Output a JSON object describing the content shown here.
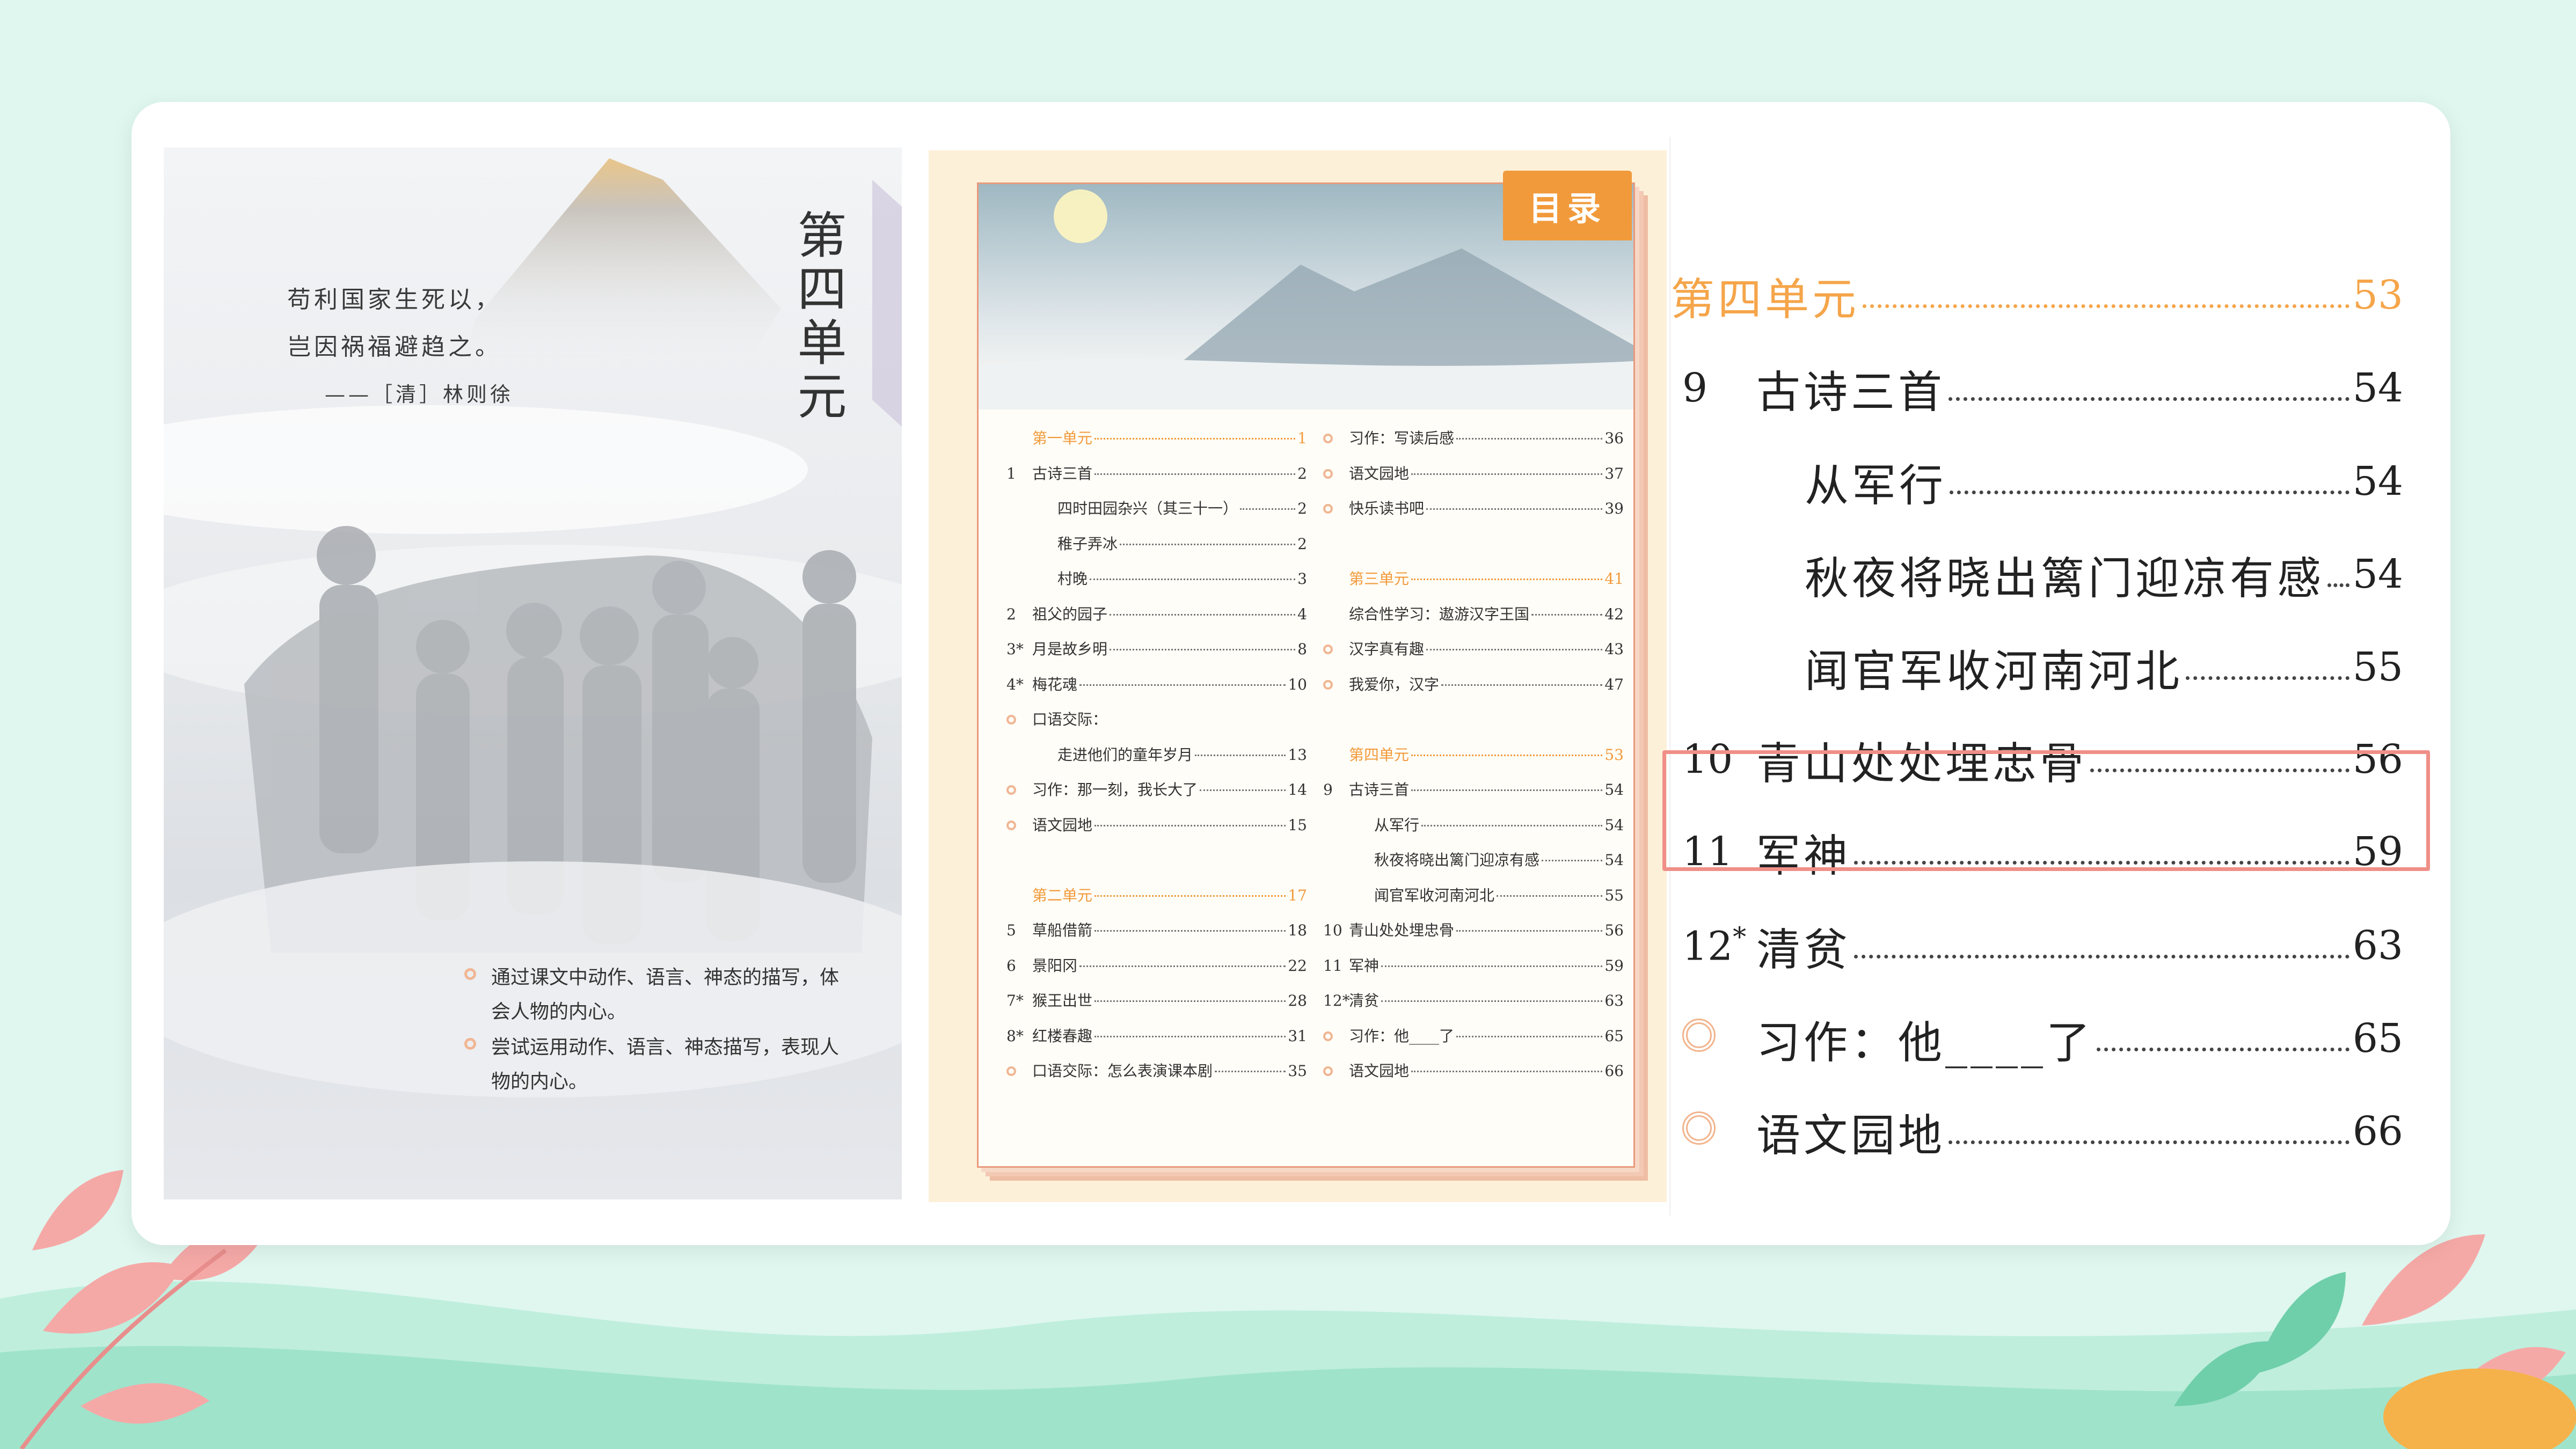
{
  "cover": {
    "title": "第四单元",
    "poem_line1": "苟利国家生死以，",
    "poem_line2": "岂因祸福避趋之。",
    "poem_author": "——［清］林则徐",
    "goal1": "通过课文中动作、语言、神态的描写，体会人物的内心。",
    "goal2": "尝试运用动作、语言、神态描写，表现人物的内心。"
  },
  "toc": {
    "banner": "目录",
    "left": [
      {
        "type": "unit",
        "num": "",
        "label": "第一单元",
        "page": "1"
      },
      {
        "type": "item",
        "num": "1",
        "label": "古诗三首",
        "page": "2"
      },
      {
        "type": "sub",
        "num": "",
        "label": "四时田园杂兴（其三十一）",
        "page": "2"
      },
      {
        "type": "sub",
        "num": "",
        "label": "稚子弄冰",
        "page": "2"
      },
      {
        "type": "sub",
        "num": "",
        "label": "村晚",
        "page": "3"
      },
      {
        "type": "item",
        "num": "2",
        "label": "祖父的园子",
        "page": "4"
      },
      {
        "type": "item",
        "num": "3*",
        "label": "月是故乡明",
        "page": "8"
      },
      {
        "type": "item",
        "num": "4*",
        "label": "梅花魂",
        "page": "10"
      },
      {
        "type": "circle",
        "num": "",
        "label": "口语交际：",
        "page": ""
      },
      {
        "type": "sub",
        "num": "",
        "label": "走进他们的童年岁月",
        "page": "13"
      },
      {
        "type": "circle",
        "num": "",
        "label": "习作：那一刻，我长大了",
        "page": "14"
      },
      {
        "type": "circle",
        "num": "",
        "label": "语文园地",
        "page": "15"
      },
      {
        "type": "gap",
        "num": "",
        "label": "",
        "page": ""
      },
      {
        "type": "unit",
        "num": "",
        "label": "第二单元",
        "page": "17"
      },
      {
        "type": "item",
        "num": "5",
        "label": "草船借箭",
        "page": "18"
      },
      {
        "type": "item",
        "num": "6",
        "label": "景阳冈",
        "page": "22"
      },
      {
        "type": "item",
        "num": "7*",
        "label": "猴王出世",
        "page": "28"
      },
      {
        "type": "item",
        "num": "8*",
        "label": "红楼春趣",
        "page": "31"
      },
      {
        "type": "circle",
        "num": "",
        "label": "口语交际：怎么表演课本剧",
        "page": "35"
      }
    ],
    "right": [
      {
        "type": "circle",
        "num": "",
        "label": "习作：写读后感",
        "page": "36"
      },
      {
        "type": "circle",
        "num": "",
        "label": "语文园地",
        "page": "37"
      },
      {
        "type": "circle",
        "num": "",
        "label": "快乐读书吧",
        "page": "39"
      },
      {
        "type": "gap",
        "num": "",
        "label": "",
        "page": ""
      },
      {
        "type": "unit",
        "num": "",
        "label": "第三单元",
        "page": "41"
      },
      {
        "type": "item",
        "num": "",
        "label": "综合性学习：遨游汉字王国",
        "page": "42"
      },
      {
        "type": "circle",
        "num": "",
        "label": "汉字真有趣",
        "page": "43"
      },
      {
        "type": "circle",
        "num": "",
        "label": "我爱你，汉字",
        "page": "47"
      },
      {
        "type": "gap",
        "num": "",
        "label": "",
        "page": ""
      },
      {
        "type": "unit",
        "num": "",
        "label": "第四单元",
        "page": "53"
      },
      {
        "type": "item",
        "num": "9",
        "label": "古诗三首",
        "page": "54"
      },
      {
        "type": "sub",
        "num": "",
        "label": "从军行",
        "page": "54"
      },
      {
        "type": "sub",
        "num": "",
        "label": "秋夜将晓出篱门迎凉有感",
        "page": "54"
      },
      {
        "type": "sub",
        "num": "",
        "label": "闻官军收河南河北",
        "page": "55"
      },
      {
        "type": "item",
        "num": "10",
        "label": "青山处处埋忠骨",
        "page": "56"
      },
      {
        "type": "item",
        "num": "11",
        "label": "军神",
        "page": "59"
      },
      {
        "type": "item",
        "num": "12*",
        "label": "清贫",
        "page": "63"
      },
      {
        "type": "circle",
        "num": "",
        "label": "习作：他____了",
        "page": "65"
      },
      {
        "type": "circle",
        "num": "",
        "label": "语文园地",
        "page": "66"
      }
    ]
  },
  "zoom": {
    "unit_label": "第四单元",
    "unit_page": "53",
    "r1_num": "9",
    "r1_label": "古诗三首",
    "r1_page": "54",
    "r2_label": "从军行",
    "r2_page": "54",
    "r3_label": "秋夜将晓出篱门迎凉有感",
    "r3_page": "54",
    "r4_label": "闻官军收河南河北",
    "r4_page": "55",
    "r5_num": "10",
    "r5_label": "青山处处埋忠骨",
    "r5_page": "56",
    "r6_num": "11",
    "r6_label": "军神",
    "r6_page": "59",
    "r7_num": "12",
    "r7_sup": "*",
    "r7_label": "清贫",
    "r7_page": "63",
    "r8_label": "习作：他____了",
    "r8_page": "65",
    "r9_label": "语文园地",
    "r9_page": "66"
  },
  "colors": {
    "background": "#dff7ef",
    "unit_orange": "#f5a54a",
    "highlight_border": "#ef8f87",
    "banner": "#f19a3b"
  }
}
